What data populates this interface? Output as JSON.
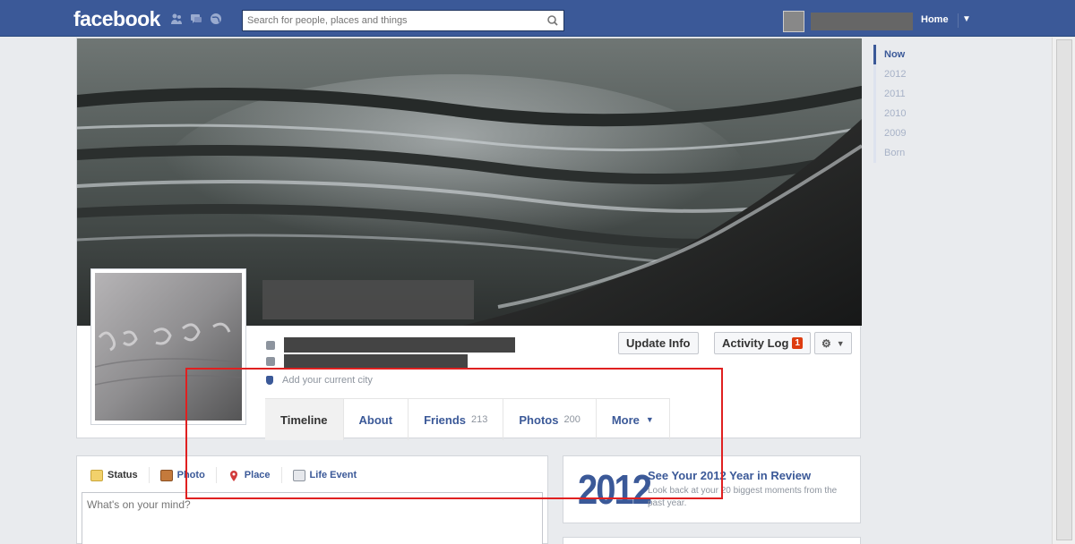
{
  "topbar": {
    "logo": "facebook",
    "search_placeholder": "Search for people, places and things",
    "home_label": "Home",
    "icons": [
      "friends-icon",
      "messages-icon",
      "notifications-icon",
      "search-icon",
      "account-caret-icon"
    ]
  },
  "year_nav": [
    "Now",
    "2012",
    "2011",
    "2010",
    "2009",
    "Born"
  ],
  "profile": {
    "current_city_prompt": "Add your current city",
    "update_info": "Update Info",
    "activity_log": "Activity Log",
    "activity_log_count": "1"
  },
  "tabs": [
    {
      "label": "Timeline",
      "count": ""
    },
    {
      "label": "About",
      "count": ""
    },
    {
      "label": "Friends",
      "count": "213"
    },
    {
      "label": "Photos",
      "count": "200"
    },
    {
      "label": "More",
      "count": ""
    }
  ],
  "composer": {
    "tabs": [
      "Status",
      "Photo",
      "Place",
      "Life Event"
    ],
    "placeholder": "What's on your mind?"
  },
  "year_review": {
    "year": "2012",
    "title": "See Your 2012 Year in Review",
    "description": "Look back at your 20 biggest moments from the past year."
  },
  "colors": {
    "brand": "#3b5998",
    "highlight": "#e02020",
    "badge": "#dd3c10"
  }
}
